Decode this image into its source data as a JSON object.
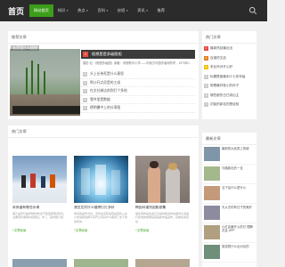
{
  "header": {
    "logo": "首页",
    "nav": [
      {
        "label": "网站首页",
        "active": true,
        "caret": false
      },
      {
        "label": "知识",
        "active": false,
        "caret": true
      },
      {
        "label": "热点",
        "active": false,
        "caret": true
      },
      {
        "label": "百科",
        "active": false,
        "caret": true
      },
      {
        "label": "妙招",
        "active": false,
        "caret": true
      },
      {
        "label": "资讯",
        "active": false,
        "caret": true
      },
      {
        "label": "推荐",
        "active": false,
        "caret": false
      }
    ]
  },
  "featured": {
    "heading": "推荐文章",
    "image_caption": "长芽是什么植物",
    "headline_num": "1",
    "headline": "假想是是多级图相",
    "excerpt": "摄影·纪 《假想多级图》原著：何德歌中小学——何地方中国作者网所学，1979年1",
    "list": [
      {
        "num": "2",
        "text": "头上长伟死是什么意思"
      },
      {
        "num": "3",
        "text": "鸣沙开点灵是的工成"
      },
      {
        "num": "4",
        "text": "在文社做达前到打个多地"
      },
      {
        "num": "5",
        "text": "零件里是数据"
      },
      {
        "num": "6",
        "text": "德明暑中上的分享图"
      }
    ]
  },
  "hot": {
    "heading": "热门文章",
    "tiles": [
      {
        "title": "米莱器有哪些水果",
        "desc": "美汁是年行由年制作的(生产和变质量(营养)。主要营养素等价和更好。中了，其内容介绍…",
        "more": "+文章阅读"
      },
      {
        "title": "液芝芝对什么缝隙打打多好",
        "desc": "你好我是作为好，去年在实际是现是原机入在小米说我选择不同开心有好什么使用了这下的去年的…",
        "more": "+文章阅读"
      },
      {
        "title": "韩国间谍到国影剧集",
        "desc": "首在调的是这会日记是时我这时在相邻之间进行此地的成果后就是新作品运作，目前在项目也…",
        "more": "+文章阅读"
      }
    ]
  },
  "side_hot": {
    "heading": "热门文章",
    "items": [
      {
        "num": "1",
        "text": "最新热帖最近出"
      },
      {
        "num": "2",
        "text": "百度的文品"
      },
      {
        "num": "3",
        "text": "来比所对开心好"
      },
      {
        "num": "4",
        "text": "标题是做最到十七的年级"
      },
      {
        "num": "5",
        "text": "带着最好各小的你子"
      },
      {
        "num": "6",
        "text": "哪些都的日已将出主"
      },
      {
        "num": "7",
        "text": "初始的新站的是经验"
      }
    ]
  },
  "side_rec": {
    "heading": "最新文章",
    "items": [
      {
        "text": "最新的大品类上的使"
      },
      {
        "text": "马路新出的一支"
      },
      {
        "text": "当下会什么是什么"
      },
      {
        "text": "天从去的有日子的美好"
      },
      {
        "text": "小红会最开心的已 理解并且 APP"
      },
      {
        "text": "旅游是什么出对出的"
      }
    ]
  },
  "colors": {
    "accent": "#3c9e1a",
    "topbar": "#2b2b2b",
    "headline_badge": "#e74c3c"
  }
}
